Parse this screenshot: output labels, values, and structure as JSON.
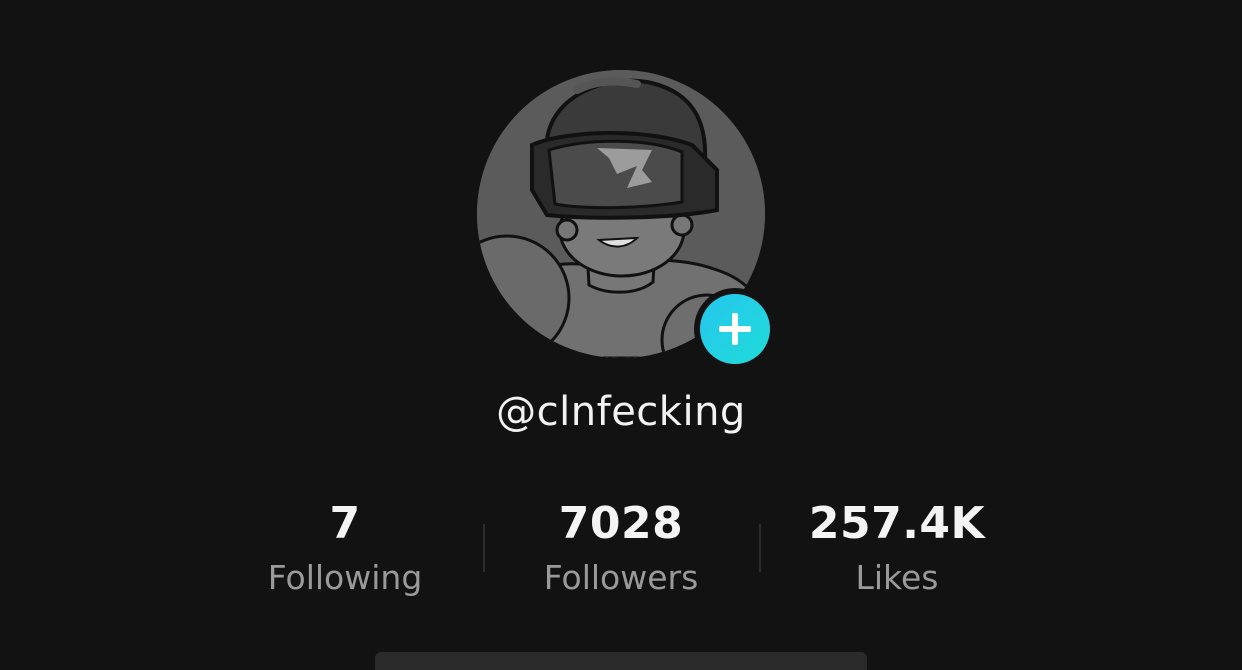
{
  "profile": {
    "username": "@clnfecking",
    "avatar_icon": "avatar-vr-headset-character"
  },
  "stats": {
    "following": {
      "value": "7",
      "label": "Following"
    },
    "followers": {
      "value": "7028",
      "label": "Followers"
    },
    "likes": {
      "value": "257.4K",
      "label": "Likes"
    }
  },
  "colors": {
    "background": "#121212",
    "accent": "#20d5e6",
    "text_primary": "#f2f2f2",
    "text_secondary": "#9a9a9a"
  }
}
